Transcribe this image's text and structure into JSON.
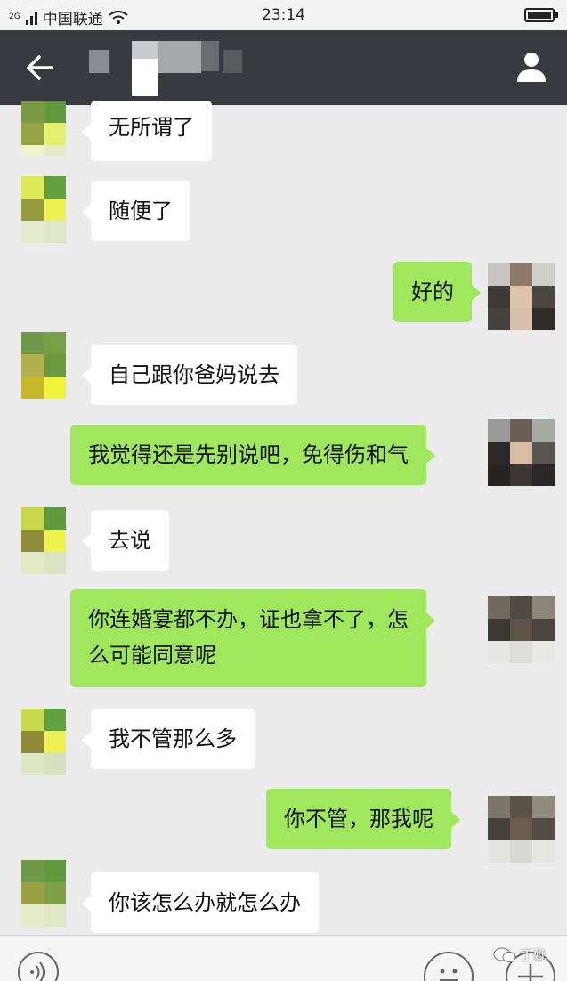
{
  "status_bar": {
    "network_label": "2G",
    "carrier": "中国联通",
    "time": "23:14"
  },
  "header": {
    "back_icon": "arrow-left-icon",
    "contact_name_state": "pixelated",
    "profile_icon": "person-icon"
  },
  "colors": {
    "header_bg": "#393a3f",
    "chat_bg": "#ebebeb",
    "incoming_bubble": "#ffffff",
    "outgoing_bubble": "#9fe75c"
  },
  "messages": [
    {
      "side": "incoming",
      "text": "无所谓了"
    },
    {
      "side": "incoming",
      "text": "随便了"
    },
    {
      "side": "outgoing",
      "text": "好的"
    },
    {
      "side": "incoming",
      "text": "自己跟你爸妈说去"
    },
    {
      "side": "outgoing",
      "text": "我觉得还是先别说吧，免得伤和气"
    },
    {
      "side": "incoming",
      "text": "去说"
    },
    {
      "side": "outgoing",
      "lines": [
        "你连婚宴都不办，证也拿不了，怎",
        "么可能同意呢"
      ]
    },
    {
      "side": "incoming",
      "text": "我不管那么多"
    },
    {
      "side": "outgoing",
      "text": "你不管，那我呢"
    },
    {
      "side": "incoming",
      "text": "你该怎么办就怎么办"
    }
  ],
  "toolbar": {
    "voice_icon": "voice-icon",
    "emoji_icon": "emoji-icon",
    "plus_icon": "plus-icon"
  },
  "watermark": {
    "text": "丁妣"
  }
}
